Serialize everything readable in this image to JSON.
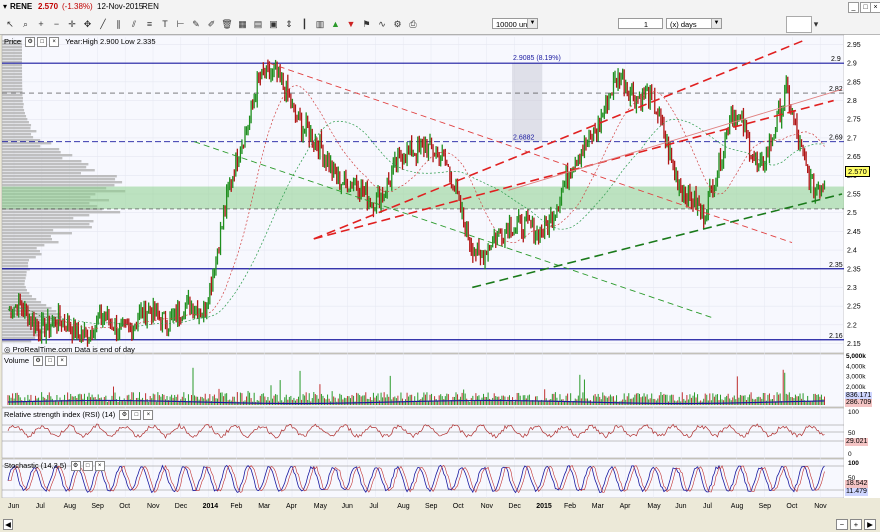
{
  "window": {
    "symbol": "RENE",
    "price": "2.570",
    "change": "(-1.38%)",
    "date": "12-Nov-2015",
    "code": "REN"
  },
  "toolbar": {
    "units_value": "10000 units",
    "period_value": "1",
    "period_unit": "(x) days",
    "icons": [
      "cursor-icon",
      "magnifier-icon",
      "zoom-in-icon",
      "zoom-out-icon",
      "crosshair-icon",
      "pan-icon",
      "line-draw-icon",
      "parallel-line-icon",
      "channel-icon",
      "fibonacci-icon",
      "text-icon",
      "ruler-icon",
      "pencil-icon",
      "brush-icon",
      "delete-icon",
      "layout-icon",
      "grid-icon",
      "period-icon",
      "scale-icon",
      "bars-icon",
      "candles-icon",
      "arrow-up-icon",
      "arrow-down-icon",
      "alert-icon",
      "indicator-icon",
      "settings-icon",
      "print-icon"
    ]
  },
  "price_panel": {
    "label": "Price",
    "info": "Year:High 2.900 Low 2.335",
    "footer": "ProRealTime.com  Data is end of day",
    "current_price": "2.570",
    "hline_labels": [
      {
        "text": "2.9085 (8.19%)",
        "price": 2.9
      },
      {
        "text": "2.9",
        "price": 2.9
      },
      {
        "text": "2.82",
        "price": 2.82
      },
      {
        "text": "2.6882",
        "price": 2.6882
      },
      {
        "text": "2.69",
        "price": 2.69
      },
      {
        "text": "2.35",
        "price": 2.35
      },
      {
        "text": "2.16",
        "price": 2.16
      }
    ]
  },
  "volume_panel": {
    "label": "Volume",
    "ticks": [
      "5,000k",
      "4,000k",
      "3,000k",
      "2,000k",
      "1,000k"
    ],
    "value1": "836.171",
    "value2": "286.709"
  },
  "rsi_panel": {
    "label": "Relative strength index (RSI) (14)",
    "ticks": [
      "100",
      "50",
      "0"
    ],
    "value": "29.021"
  },
  "stoch_panel": {
    "label": "Stochastic (14,3,5)",
    "ticks": [
      "100",
      "50",
      "0"
    ],
    "value1": "18.542",
    "value2": "11.479"
  },
  "chart_data": {
    "type": "line",
    "title": "RENE",
    "y_ticks": [
      "2.95",
      "2.9",
      "2.85",
      "2.8",
      "2.75",
      "2.7",
      "2.65",
      "2.6",
      "2.55",
      "2.5",
      "2.45",
      "2.4",
      "2.35",
      "2.3",
      "2.25",
      "2.2",
      "2.15"
    ],
    "ylim": [
      2.13,
      2.97
    ],
    "x_ticks": [
      "Jun",
      "Jul",
      "Aug",
      "Sep",
      "Oct",
      "Nov",
      "Dec",
      "2014",
      "Feb",
      "Mar",
      "Apr",
      "May",
      "Jun",
      "Jul",
      "Aug",
      "Sep",
      "Oct",
      "Nov",
      "Dec",
      "2015",
      "Feb",
      "Mar",
      "Apr",
      "May",
      "Jun",
      "Jul",
      "Aug",
      "Sep",
      "Oct",
      "Nov"
    ],
    "x": [
      "2013-06",
      "2013-08",
      "2013-10",
      "2013-11",
      "2013-12",
      "2014-01",
      "2014-02",
      "2014-03",
      "2014-04",
      "2014-05",
      "2014-06",
      "2014-07",
      "2014-08",
      "2014-09",
      "2014-10",
      "2014-11",
      "2014-12",
      "2015-01",
      "2015-02",
      "2015-03",
      "2015-04",
      "2015-05",
      "2015-06",
      "2015-07",
      "2015-08",
      "2015-09",
      "2015-10",
      "2015-11"
    ],
    "series": [
      {
        "values": [
          2.24,
          2.19,
          2.2,
          2.22,
          2.23,
          2.24,
          2.56,
          2.87,
          2.83,
          2.68,
          2.6,
          2.53,
          2.62,
          2.7,
          2.58,
          2.36,
          2.49,
          2.43,
          2.57,
          2.72,
          2.85,
          2.82,
          2.62,
          2.47,
          2.78,
          2.62,
          2.8,
          2.57
        ]
      }
    ]
  }
}
